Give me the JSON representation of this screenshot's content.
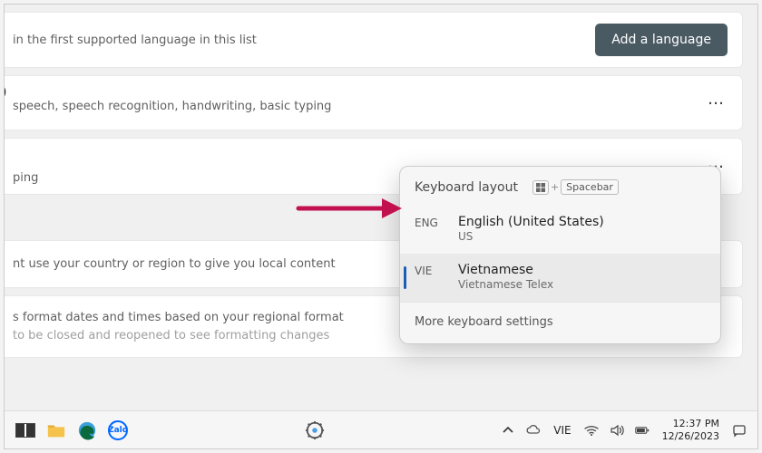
{
  "header": {
    "pref_text": "in the first supported language in this list",
    "add_button": "Add a language"
  },
  "lang_rows": [
    {
      "sub": "speech, speech recognition, handwriting, basic typing"
    },
    {
      "sub": "ping"
    }
  ],
  "region": {
    "content_note": "nt use your country or region to give you local content",
    "format_note_l1": "s format dates and times based on your regional format",
    "format_note_l2": "to be closed and reopened to see formatting changes"
  },
  "flyout": {
    "title": "Keyboard layout",
    "shortcut_spacebar": "Spacebar",
    "items": [
      {
        "code": "ENG",
        "name": "English (United States)",
        "sub": "US",
        "selected": false
      },
      {
        "code": "VIE",
        "name": "Vietnamese",
        "sub": "Vietnamese Telex",
        "selected": true
      }
    ],
    "more": "More keyboard settings"
  },
  "taskbar": {
    "ime": "VIE",
    "time": "12:37 PM",
    "date": "12/26/2023"
  }
}
